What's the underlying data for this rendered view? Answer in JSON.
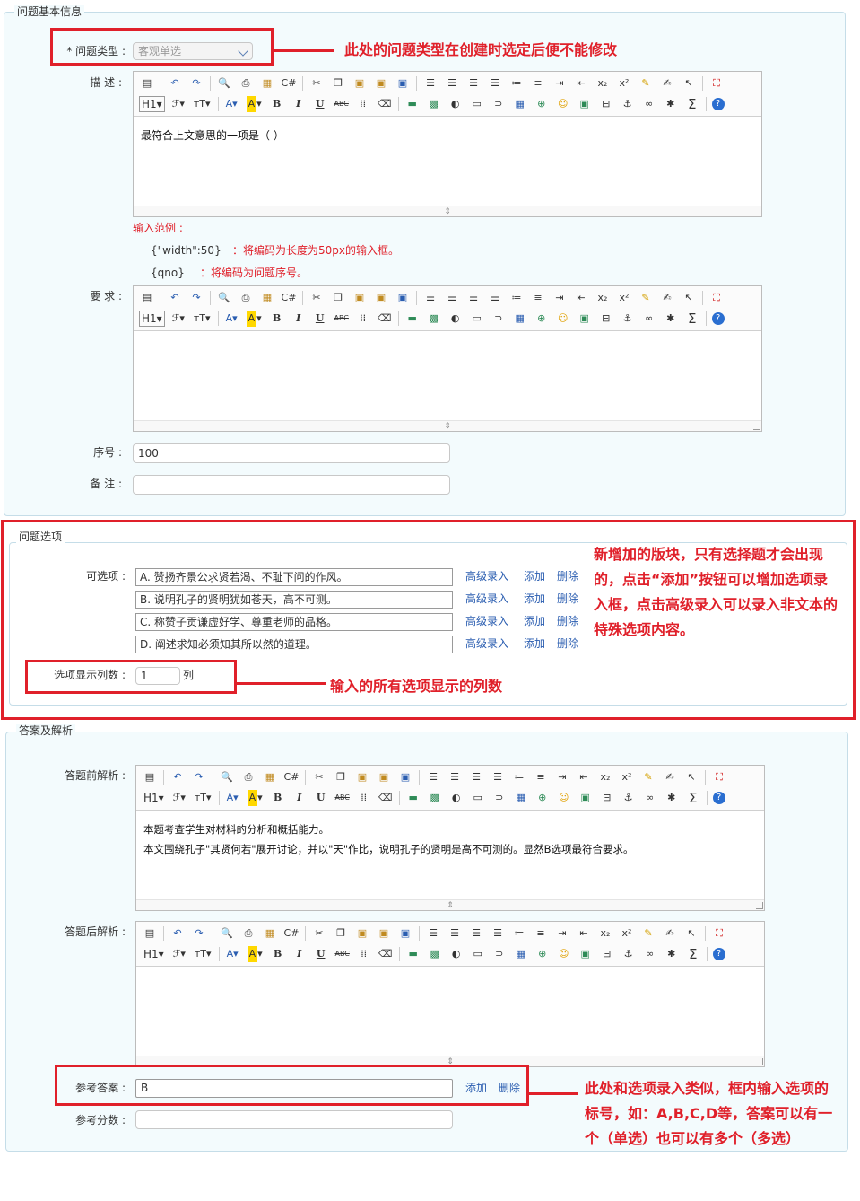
{
  "section1": {
    "title": "问题基本信息",
    "type_label": "* 问题类型 :",
    "type_value": "客观单选",
    "desc_label": "描 述 :",
    "desc_content": "最符合上文意思的一项是（ ）",
    "hint_title": "输入范例 :",
    "hint1_code": "{\"width\":50}",
    "hint1_text": "：将编码为长度为50px的输入框。",
    "hint2_code": "{qno}",
    "hint2_text": "：将编码为问题序号。",
    "req_label": "要 求 :",
    "seq_label": "序号 :",
    "seq_value": "100",
    "note_label": "备 注 :",
    "note_value": ""
  },
  "section2": {
    "title": "问题选项",
    "options_label": "可选项 :",
    "options": [
      {
        "text": "A. 赞扬齐景公求贤若渴、不耻下问的作风。"
      },
      {
        "text": "B. 说明孔子的贤明犹如苍天，高不可测。"
      },
      {
        "text": "C. 称赞子贡谦虚好学、尊重老师的品格。"
      },
      {
        "text": "D. 阐述求知必须知其所以然的道理。"
      }
    ],
    "adv_label": "高级录入",
    "add_label": "添加",
    "del_label": "删除",
    "cols_label": "选项显示列数 :",
    "cols_value": "1",
    "cols_unit": "列"
  },
  "section3": {
    "title": "答案及解析",
    "pre_label": "答题前解析 :",
    "pre_line1": "本题考查学生对材料的分析和概括能力。",
    "pre_line2": "本文围绕孔子\"其贤何若\"展开讨论，并以\"天\"作比，说明孔子的贤明是高不可测的。显然B选项最符合要求。",
    "post_label": "答题后解析 :",
    "ans_label": "参考答案 :",
    "ans_value": "B",
    "ans_add": "添加",
    "ans_del": "删除",
    "score_label": "参考分数 :",
    "score_value": ""
  },
  "annotations": {
    "a1": "此处的问题类型在创建时选定后便不能修改",
    "a2_l1": "新增加的版块，只有选择题才会出现",
    "a2_l2": "的，点击“添加”按钮可以增加选项录",
    "a2_l3": "入框，点击高级录入可以录入非文本的",
    "a2_l4": "特殊选项内容。",
    "a3": "输入的所有选项显示的列数",
    "a4_l1": "此处和选项录入类似，框内输入选项的",
    "a4_l2": "标号，如：A,B,C,D等，答案可以有一",
    "a4_l3": "个（单选）也可以有多个（多选）"
  },
  "toolbar": {
    "h1": "H1",
    "font": "ℱ",
    "size": "тT",
    "color": "A",
    "bg": "A",
    "bold": "B",
    "italic": "I",
    "underline": "U",
    "strike": "ABC",
    "sigma": "Σ",
    "help": "?",
    "sub": "x₂",
    "sup": "x²"
  },
  "colors": {
    "red": "#e0202a",
    "panel_bg": "#f3fbfd",
    "link": "#2a5db0"
  }
}
